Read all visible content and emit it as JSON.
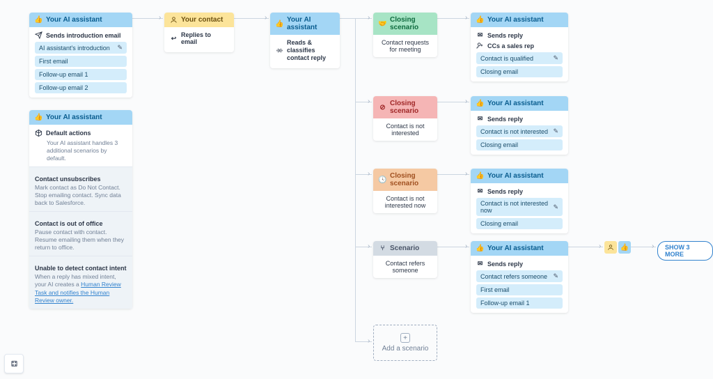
{
  "nodes": {
    "ai1": {
      "title": "Your AI assistant",
      "action": "Sends introduction email",
      "chips": [
        "AI assistant's introduction",
        "First email",
        "Follow-up email 1",
        "Follow-up email 2"
      ]
    },
    "contact": {
      "title": "Your contact",
      "action": "Replies to email"
    },
    "ai2": {
      "title": "Your AI assistant",
      "action": "Reads & classifies contact reply"
    },
    "close_green": {
      "title": "Closing scenario",
      "body": "Contact requests for meeting"
    },
    "close_red": {
      "title": "Closing scenario",
      "body": "Contact is not interested"
    },
    "close_orange": {
      "title": "Closing scenario",
      "body": "Contact is not interested now"
    },
    "scenario_gray": {
      "title": "Scenario",
      "body": "Contact refers someone"
    },
    "ai_green": {
      "title": "Your AI assistant",
      "row1": "Sends reply",
      "row2": "CCs a sales rep",
      "chips": [
        "Contact is qualified",
        "Closing email"
      ]
    },
    "ai_red": {
      "title": "Your AI assistant",
      "row1": "Sends reply",
      "chips": [
        "Contact is not interested",
        "Closing email"
      ]
    },
    "ai_orange": {
      "title": "Your AI assistant",
      "row1": "Sends reply",
      "chips": [
        "Contact is not interested now",
        "Closing email"
      ]
    },
    "ai_gray": {
      "title": "Your AI assistant",
      "row1": "Sends reply",
      "chips": [
        "Contact refers someone",
        "First email",
        "Follow-up email 1"
      ]
    },
    "defaults": {
      "title": "Your AI assistant",
      "heading": "Default actions",
      "subheading": "Your AI assistant handles 3 additional scenarios by default.",
      "s1_label": "Contact unsubscribes",
      "s1_text": "Mark contact as Do Not Contact. Stop emailing contact. Sync data back to Salesforce.",
      "s2_label": "Contact is out of office",
      "s2_text": "Pause contact with contact. Resume emailing them when they return to office.",
      "s3_label": "Unable to detect contact intent",
      "s3_text_a": "When a reply has mixed intent, your AI creates a ",
      "s3_link": "Human Review Task and notifies the Human Review owner."
    }
  },
  "add_label": "Add a scenario",
  "show_more": "SHOW 3 MORE"
}
